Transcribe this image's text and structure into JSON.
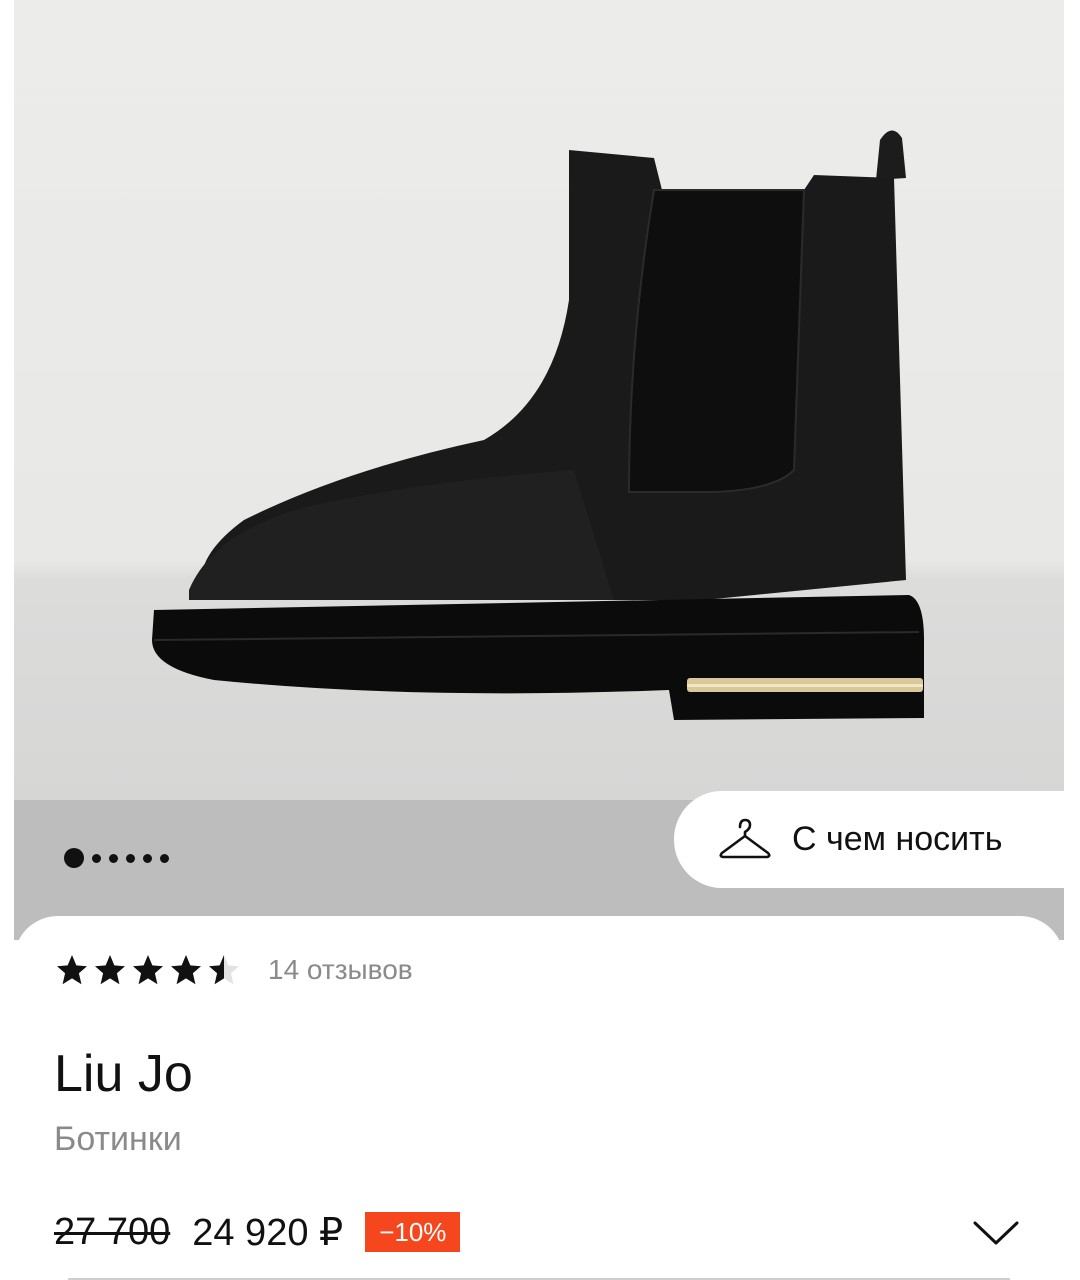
{
  "product_image": {
    "gallery_pages": 6,
    "active_page": 1
  },
  "wear_with": {
    "label": "С чем носить",
    "icon": "hanger-icon"
  },
  "rating": {
    "stars": 4.5,
    "max_stars": 5,
    "reviews": "14 отзывов"
  },
  "product": {
    "brand": "Liu Jo",
    "category": "Ботинки"
  },
  "price": {
    "old": "27 700",
    "current": "24 920 ₽",
    "discount": "−10%"
  },
  "colors": {
    "discount_badge": "#f5461e",
    "text": "#111111",
    "muted_text": "#8a8a8a"
  }
}
